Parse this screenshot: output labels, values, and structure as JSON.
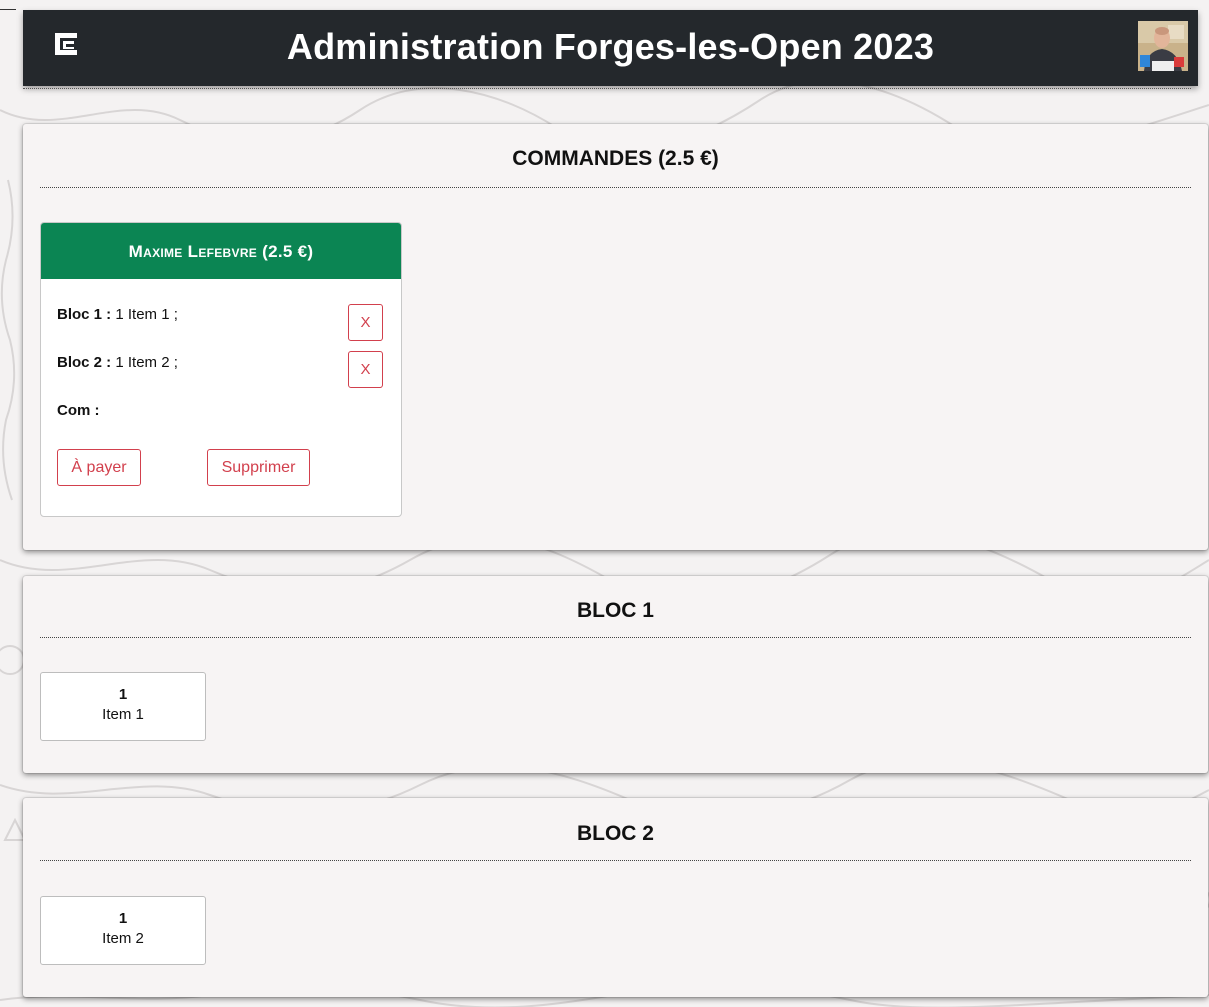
{
  "header": {
    "title": "Administration Forges-les-Open 2023",
    "logo_icon": "logo-icon",
    "avatar_icon": "user-avatar"
  },
  "orders": {
    "title": "COMMANDES (2.5 €)",
    "cards": [
      {
        "customer": "Maxime Lefebvre (2.5 €)",
        "lines": [
          {
            "label": "Bloc 1 :",
            "value": "1 Item 1 ;",
            "remove": "X"
          },
          {
            "label": "Bloc 2 :",
            "value": "1 Item 2 ;",
            "remove": "X"
          }
        ],
        "comment_label": "Com :",
        "pay_button": "À payer",
        "delete_button": "Supprimer"
      }
    ]
  },
  "blocs": [
    {
      "title": "BLOC 1",
      "items": [
        {
          "qty": "1",
          "name": "Item 1"
        }
      ]
    },
    {
      "title": "BLOC 2",
      "items": [
        {
          "qty": "1",
          "name": "Item 2"
        }
      ]
    }
  ],
  "colors": {
    "header_bg": "#24282c",
    "card_header_green": "#0b8553",
    "danger_red": "#d2404d",
    "panel_bg": "#f7f4f4"
  }
}
